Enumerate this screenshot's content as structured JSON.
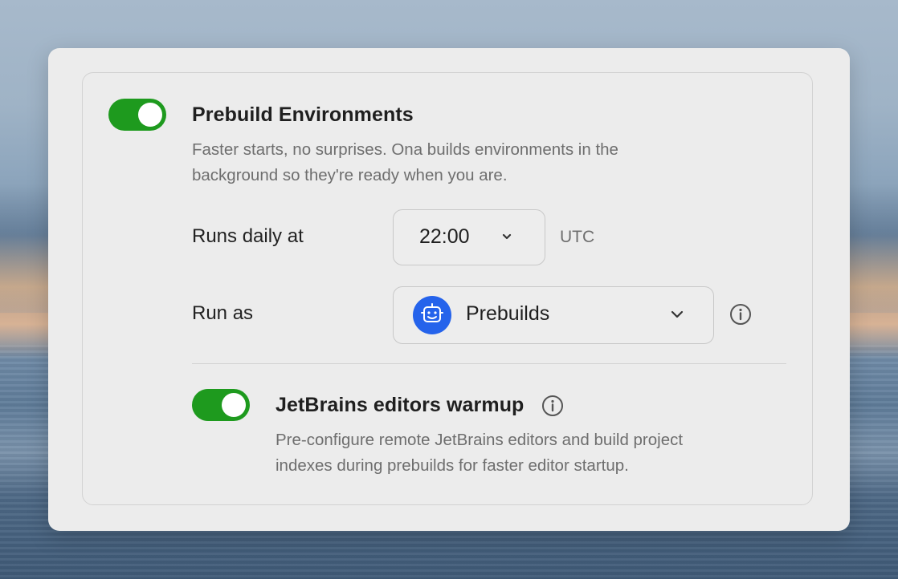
{
  "prebuild": {
    "enabled": true,
    "title": "Prebuild Environments",
    "description_line1": "Faster starts, no surprises. Ona builds environments in the",
    "description_line2": "background so they're ready when you are.",
    "runs_daily_label": "Runs daily at",
    "time_value": "22:00",
    "timezone": "UTC",
    "run_as_label": "Run as",
    "run_as_value": "Prebuilds",
    "run_as_icon": "robot-icon"
  },
  "jetbrains": {
    "enabled": true,
    "title": "JetBrains editors warmup",
    "description_line1": "Pre-configure remote JetBrains editors and build project",
    "description_line2": "indexes during prebuilds for faster editor startup."
  },
  "colors": {
    "toggle_on": "#1e9a1e",
    "avatar_bg": "#2563eb"
  }
}
